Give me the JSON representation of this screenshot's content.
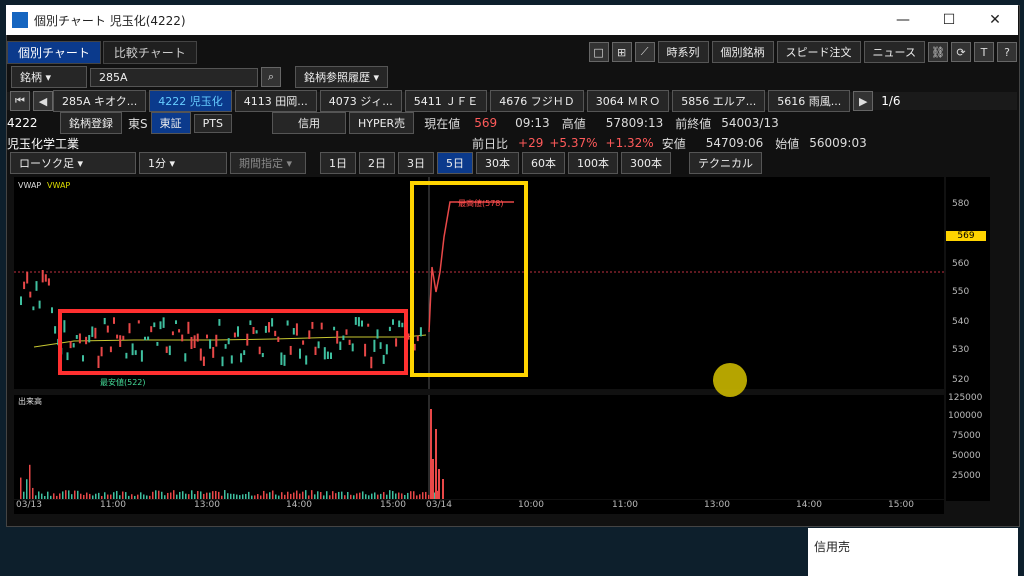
{
  "window": {
    "title": "個別チャート 児玉化(4222)",
    "minimize": "—",
    "maximize": "☐",
    "close": "✕"
  },
  "tabs": [
    {
      "label": "個別チャート",
      "active": true
    },
    {
      "label": "比較チャート",
      "active": false
    }
  ],
  "toolbar_right": [
    "時系列",
    "個別銘柄",
    "スピード注文",
    "ニュース"
  ],
  "symbol_row": {
    "label": "銘柄",
    "value": "285A"
  },
  "history_button": "銘柄参照履歴",
  "ticker_tabs": [
    "285A キオク...",
    "4222 児玉化",
    "4113 田岡...",
    "4073 ジィ...",
    "5411 ＪＦＥ",
    "4676 フジＨＤ",
    "3064 ＭＲＯ",
    "5856 エルア...",
    "5616 雨風..."
  ],
  "page_indicator": "1/6",
  "stock": {
    "code": "4222",
    "name": "児玉化学工業",
    "register": "銘柄登録",
    "market": "東S",
    "mode1": "東証",
    "mode2": "PTS",
    "credit": "信用",
    "hyper": "HYPER売",
    "current_label": "現在値",
    "current": "569",
    "time": "09:13",
    "prev_label": "前日比",
    "change": "+29",
    "change_pct": "+5.37%",
    "change2": "+1.32%",
    "high_label": "高値",
    "high": "578",
    "high_time": "09:13",
    "low_label": "安値",
    "low": "547",
    "low_time": "09:06",
    "prevclose_label": "前終値",
    "prevclose": "540",
    "prevclose_date": "03/13",
    "open_label": "始値",
    "open": "560",
    "open_time": "09:03"
  },
  "period_row": {
    "chart_type": "ローソク足",
    "interval": "1分",
    "period": "期間指定",
    "days": [
      "1日",
      "2日",
      "3日",
      "5日",
      "30本",
      "60本",
      "100本",
      "300本"
    ],
    "technical": "テクニカル"
  },
  "chart_data": {
    "type": "candlestick",
    "legend": [
      "VWAP",
      "VWAP"
    ],
    "y_ticks": [
      "580",
      "569",
      "560",
      "550",
      "540",
      "530",
      "520"
    ],
    "current_price_label": "569",
    "high_annotation": "最高値(578)",
    "low_annotation": "最安値(522)",
    "x_labels": [
      "03/13",
      "11:00",
      "13:00",
      "14:00",
      "15:00",
      "03/14",
      "10:00",
      "11:00",
      "13:00",
      "14:00",
      "15:00"
    ],
    "volume_title": "出来高",
    "volume_ticks": [
      "125000",
      "100000",
      "75000",
      "50000",
      "25000"
    ],
    "highlight_colors": {
      "red": "#ff3030",
      "yellow": "#ffd400"
    }
  },
  "bottom_panel": {
    "label": "信用売"
  }
}
